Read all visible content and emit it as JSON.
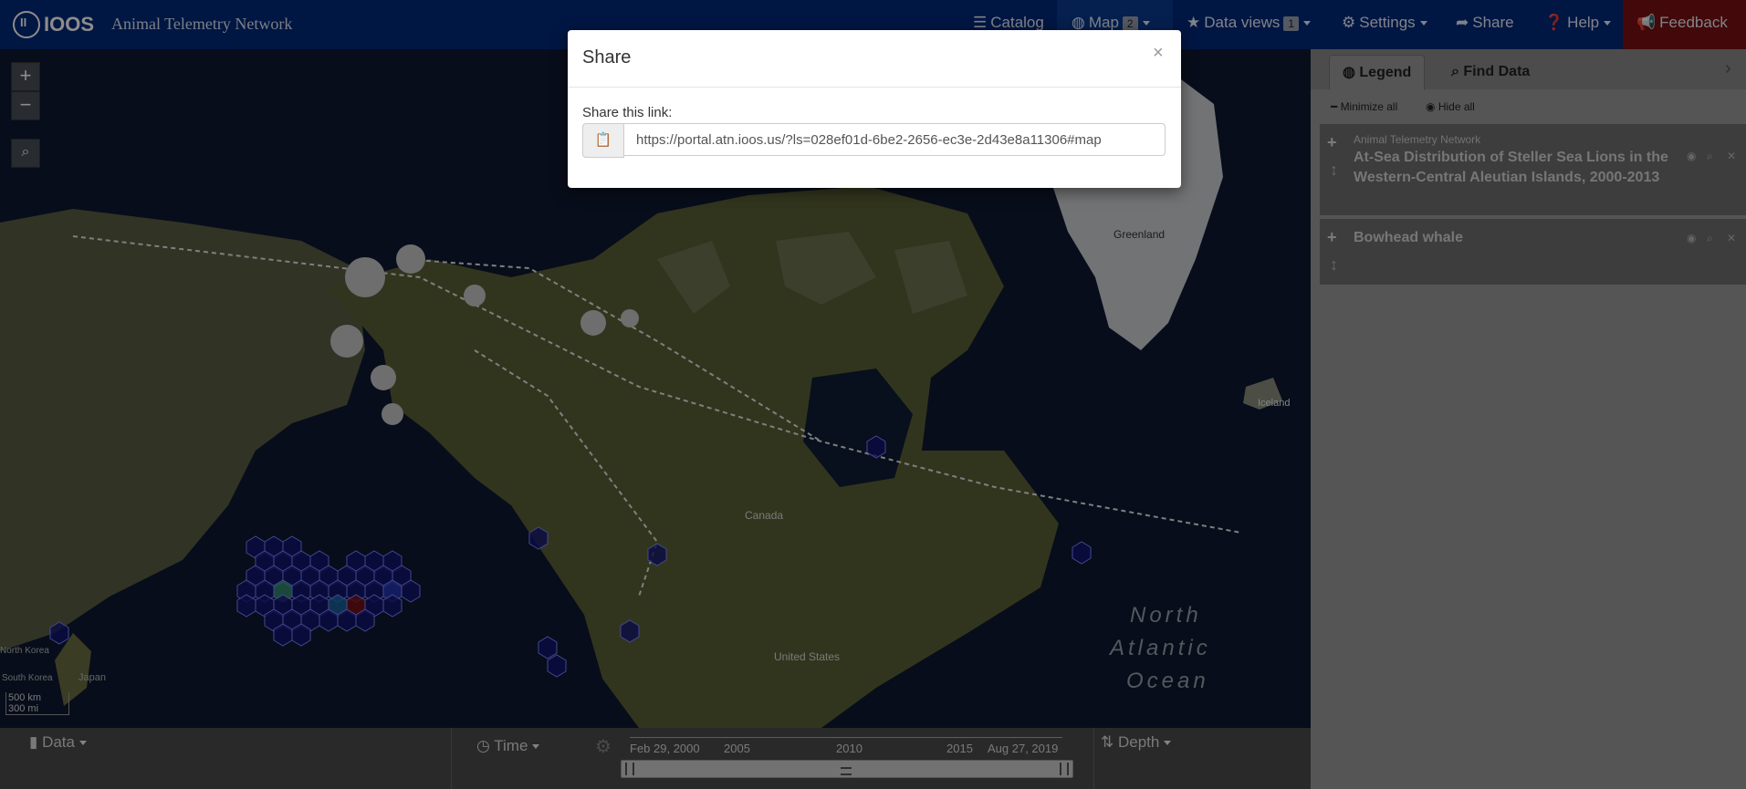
{
  "navbar": {
    "logo_text": "IOOS",
    "app_title": "Animal Telemetry Network",
    "items": [
      {
        "label": "Catalog",
        "icon": "list-icon"
      },
      {
        "label": "Map",
        "icon": "globe-icon",
        "badge": "2"
      },
      {
        "label": "Data views",
        "icon": "star-icon",
        "badge": "1"
      },
      {
        "label": "Settings",
        "icon": "gear-icon"
      },
      {
        "label": "Share",
        "icon": "share-icon"
      },
      {
        "label": "Help",
        "icon": "question-icon"
      },
      {
        "label": "Feedback",
        "icon": "megaphone-icon"
      }
    ]
  },
  "map": {
    "labels": {
      "greenland": "Greenland",
      "iceland": "Iceland",
      "canada": "Canada",
      "united_states": "United States",
      "north_korea": "North Korea",
      "south_korea": "South Korea",
      "japan": "Japan",
      "ocean_line1": "North",
      "ocean_line2": "Atlantic",
      "ocean_line3": "Ocean"
    },
    "scale": {
      "km": "500 km",
      "mi": "300 mi"
    },
    "zoom_in": "+",
    "zoom_out": "−"
  },
  "modal": {
    "title": "Share",
    "close": "×",
    "link_label": "Share this link:",
    "link_value": "https://portal.atn.ioos.us/?ls=028ef01d-6be2-2656-ec3e-2d43e8a11306#map"
  },
  "panel": {
    "tabs": [
      {
        "label": "Legend",
        "icon": "globe-icon"
      },
      {
        "label": "Find Data",
        "icon": "search-icon"
      }
    ],
    "minimize_all": "Minimize all",
    "hide_all": "Hide all",
    "layers": [
      {
        "provider": "Animal Telemetry Network",
        "name": "At-Sea Distribution of Steller Sea Lions in the Western-Central Aleutian Islands, 2000-2013"
      },
      {
        "provider": "",
        "name": "Bowhead whale"
      }
    ]
  },
  "bottom": {
    "data_label": "Data",
    "time_label": "Time",
    "depth_label": "Depth",
    "timeline": {
      "start": "Feb 29, 2000",
      "end": "Aug 27, 2019",
      "ticks": [
        "2005",
        "2010",
        "2015"
      ]
    }
  }
}
